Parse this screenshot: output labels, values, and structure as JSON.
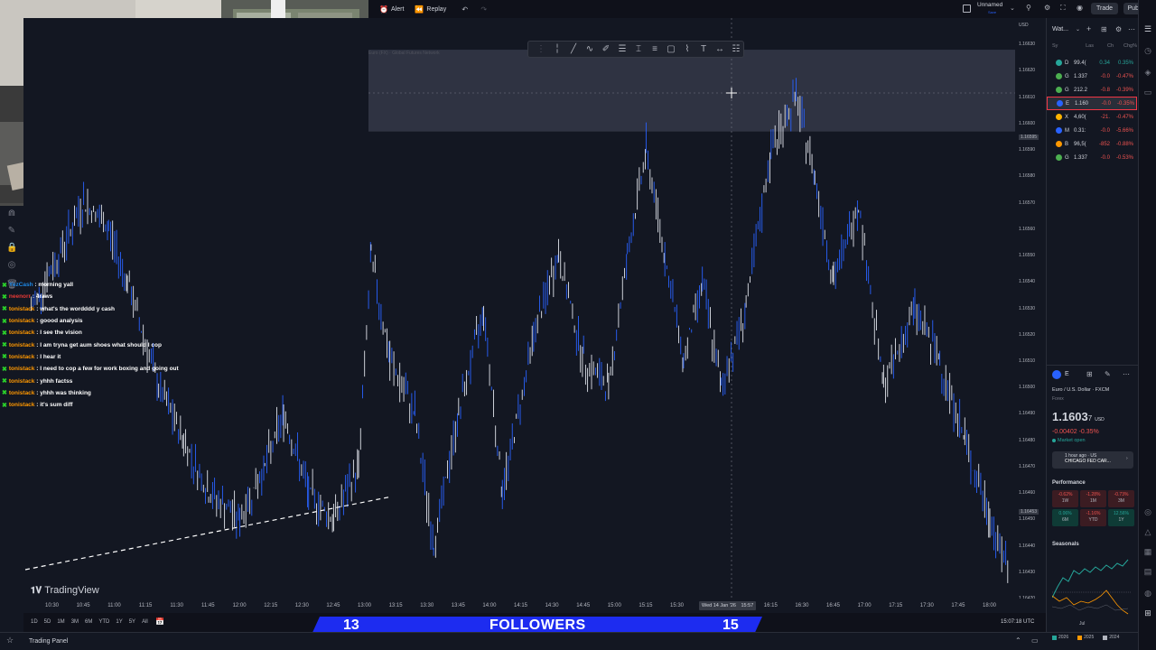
{
  "topbar": {
    "alert_label": "Alert",
    "replay_label": "Replay",
    "layout_name": "Unnamed",
    "layout_sub": "Save",
    "trade_label": "Trade",
    "publish_label": "Publish"
  },
  "chart": {
    "currency": "USD",
    "watermark": "TradingView",
    "legend_faded": "Euro (FX) · Global Futures Network",
    "crosshair_date": "Wed 14 Jan '26",
    "crosshair_time": "15:57",
    "price_labels": [
      "1.16630",
      "1.16620",
      "1.16610",
      "1.16600",
      "1.16595",
      "1.16590",
      "1.16580",
      "1.16570",
      "1.16560",
      "1.16550",
      "1.16540",
      "1.16530",
      "1.16520",
      "1.16510",
      "1.16500",
      "1.16490",
      "1.16480",
      "1.16470",
      "1.16460",
      "1.16453",
      "1.16450",
      "1.16440",
      "1.16430",
      "1.16420"
    ],
    "time_labels": [
      "10:30",
      "10:45",
      "11:00",
      "11:15",
      "11:30",
      "11:45",
      "12:00",
      "12:15",
      "12:30",
      "12:45",
      "13:00",
      "13:15",
      "13:30",
      "13:45",
      "14:00",
      "14:15",
      "14:30",
      "14:45",
      "15:00",
      "15:15",
      "15:30",
      "16:15",
      "16:30",
      "16:45",
      "17:00",
      "17:15",
      "17:30",
      "17:45",
      "18:00"
    ],
    "shaded_zone": {
      "from": 1.16597,
      "to": 1.16628
    }
  },
  "chart_data": {
    "type": "line",
    "title": "",
    "xlabel": "",
    "ylabel": "",
    "x_range": [
      "10:20",
      "18:10"
    ],
    "ylim": [
      1.1642,
      1.1664
    ],
    "series": [
      {
        "values": [
          [
            10.33,
            1.1653
          ],
          [
            10.55,
            1.1655
          ],
          [
            10.75,
            1.1657
          ],
          [
            10.95,
            1.1656
          ],
          [
            11.1,
            1.1654
          ],
          [
            11.35,
            1.165
          ],
          [
            11.55,
            1.1648
          ],
          [
            11.75,
            1.1646
          ],
          [
            12.0,
            1.1645
          ],
          [
            12.2,
            1.1647
          ],
          [
            12.35,
            1.1649
          ],
          [
            12.55,
            1.1646
          ],
          [
            12.75,
            1.1645
          ],
          [
            12.95,
            1.1647
          ],
          [
            13.05,
            1.1655
          ],
          [
            13.2,
            1.1651
          ],
          [
            13.4,
            1.1649
          ],
          [
            13.55,
            1.1644
          ],
          [
            13.75,
            1.1649
          ],
          [
            13.95,
            1.1653
          ],
          [
            14.1,
            1.1646
          ],
          [
            14.35,
            1.1652
          ],
          [
            14.55,
            1.1655
          ],
          [
            14.75,
            1.1651
          ],
          [
            14.95,
            1.165
          ],
          [
            15.1,
            1.1655
          ],
          [
            15.25,
            1.1659
          ],
          [
            15.4,
            1.1655
          ],
          [
            15.55,
            1.1651
          ],
          [
            15.7,
            1.1654
          ],
          [
            15.85,
            1.165
          ],
          [
            16.05,
            1.1653
          ],
          [
            16.25,
            1.1659
          ],
          [
            16.45,
            1.1661
          ],
          [
            16.6,
            1.1658
          ],
          [
            16.75,
            1.1654
          ],
          [
            16.95,
            1.1657
          ],
          [
            17.15,
            1.165
          ],
          [
            17.4,
            1.1653
          ],
          [
            17.6,
            1.1651
          ],
          [
            17.8,
            1.1648
          ],
          [
            18.0,
            1.1645
          ],
          [
            18.15,
            1.1643
          ]
        ]
      }
    ],
    "grid": false
  },
  "timeframes": [
    "1D",
    "5D",
    "1M",
    "3M",
    "6M",
    "YTD",
    "1Y",
    "5Y",
    "All"
  ],
  "utc_clock": "15:07:18 UTC",
  "status": {
    "trading_panel": "Trading Panel"
  },
  "followers": {
    "left_num": "13",
    "label": "FOLLOWERS",
    "right_num": "15"
  },
  "watchlist": {
    "title": "Wat...",
    "cols": [
      "Sy",
      "Las",
      "Ch",
      "Chg%"
    ],
    "rows": [
      {
        "sym": "D",
        "last": "99.4(",
        "chg": "0.34",
        "pct": "0.35%",
        "color": "#26a69a",
        "dot": "#26a69a"
      },
      {
        "sym": "G",
        "last": "1.337",
        "chg": "-0.0",
        "pct": "-0.47%",
        "color": "#ef5350",
        "dot": "#4caf50"
      },
      {
        "sym": "G",
        "last": "212.2",
        "chg": "-0.8",
        "pct": "-0.39%",
        "color": "#ef5350",
        "dot": "#4caf50"
      },
      {
        "sym": "E",
        "last": "1.160",
        "chg": "-0.0",
        "pct": "-0.35%",
        "color": "#ef5350",
        "dot": "#2962ff"
      },
      {
        "sym": "X",
        "last": "4,60(",
        "chg": "-21.",
        "pct": "-0.47%",
        "color": "#ef5350",
        "dot": "#ffb300"
      },
      {
        "sym": "M",
        "last": "0.31:",
        "chg": "-0.0",
        "pct": "-5.66%",
        "color": "#ef5350",
        "dot": "#2962ff"
      },
      {
        "sym": "B",
        "last": "96,5(",
        "chg": "-852",
        "pct": "-0.88%",
        "color": "#ef5350",
        "dot": "#ff9800"
      },
      {
        "sym": "G",
        "last": "1.337",
        "chg": "-0.0",
        "pct": "-0.53%",
        "color": "#ef5350",
        "dot": "#4caf50"
      }
    ]
  },
  "detail": {
    "sym": "E",
    "name": "Euro / U.S. Dollar · FXCM",
    "category": "Forex",
    "price_main": "1.1603",
    "price_frac": "7",
    "price_unit": "USD",
    "change": "-0.00402 -0.35%",
    "market_status": "Market open",
    "news_time": "1 hour ago · US",
    "news_title": "CHICAGO FED CAR...",
    "performance_label": "Performance",
    "perf": [
      {
        "val": "-0.62%",
        "lbl": "1W",
        "pos": false
      },
      {
        "val": "-1.28%",
        "lbl": "1M",
        "pos": false
      },
      {
        "val": "-0.73%",
        "lbl": "3M",
        "pos": false
      },
      {
        "val": "0.06%",
        "lbl": "6M",
        "pos": true
      },
      {
        "val": "-1.16%",
        "lbl": "YTD",
        "pos": false
      },
      {
        "val": "12.56%",
        "lbl": "1Y",
        "pos": true
      }
    ],
    "seasonals_label": "Seasonals",
    "seasonals_month": "Jul",
    "seasonals_years": [
      "2026",
      "2025",
      "2024"
    ]
  },
  "chat": [
    {
      "user": "YezCash",
      "msg": "morning yall",
      "ucolor": "#1e88e5"
    },
    {
      "user": "neenorr",
      "msg": "4raws",
      "ucolor": "#e53935"
    },
    {
      "user": "tonistack",
      "msg": "what's the wordddd y cash",
      "ucolor": "#ff9800"
    },
    {
      "user": "tonistack",
      "msg": "goood analysis",
      "ucolor": "#ff9800"
    },
    {
      "user": "tonistack",
      "msg": "I see the vision",
      "ucolor": "#ff9800"
    },
    {
      "user": "tonistack",
      "msg": "I am tryna get aum shoes what should I cop",
      "ucolor": "#ff9800"
    },
    {
      "user": "tonistack",
      "msg": "I hear it",
      "ucolor": "#ff9800"
    },
    {
      "user": "tonistack",
      "msg": "I need to cop a few for work boxing and going out",
      "ucolor": "#ff9800"
    },
    {
      "user": "tonistack",
      "msg": "yhhh factss",
      "ucolor": "#ff9800"
    },
    {
      "user": "tonistack",
      "msg": "yhhh was thinking",
      "ucolor": "#ff9800"
    },
    {
      "user": "tonistack",
      "msg": "it's sum diff",
      "ucolor": "#ff9800"
    }
  ]
}
